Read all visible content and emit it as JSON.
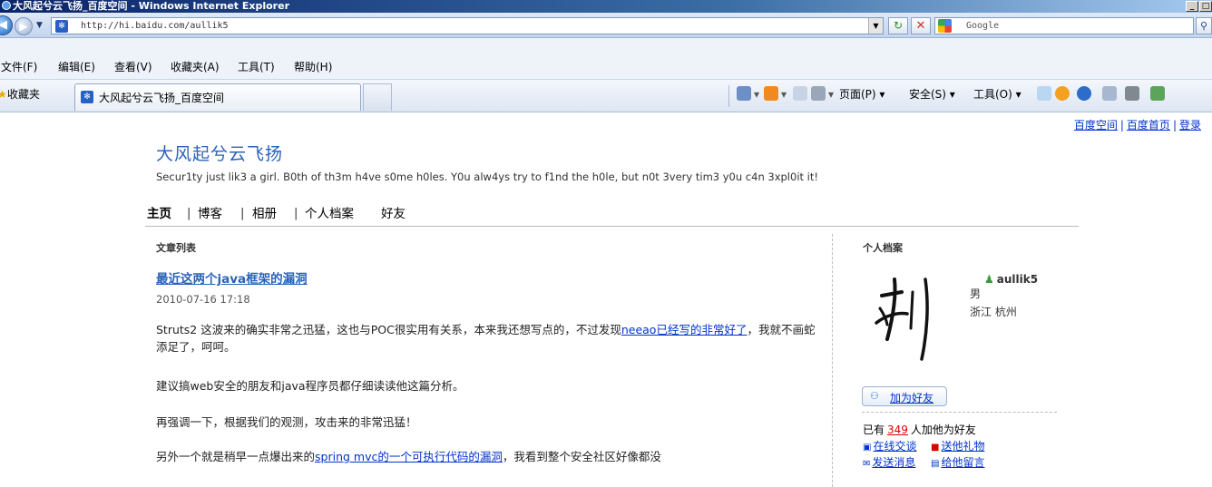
{
  "window": {
    "title": "大风起兮云飞扬_百度空间 - Windows Internet Explorer"
  },
  "address": {
    "url": "http://hi.baidu.com/aullik5",
    "search_placeholder": "Google"
  },
  "menu": {
    "items": [
      "文件(F)",
      "编辑(E)",
      "查看(V)",
      "收藏夹(A)",
      "工具(T)",
      "帮助(H)"
    ]
  },
  "favorites": {
    "label": "收藏夹",
    "tab_title": "大风起兮云飞扬_百度空间"
  },
  "commandbar": {
    "page": "页面(P) ▾",
    "safety": "安全(S) ▾",
    "tools": "工具(O) ▾"
  },
  "toplinks": [
    "百度空间",
    "百度首页",
    "登录"
  ],
  "blog": {
    "title": "大风起兮云飞扬",
    "description": "Secur1ty just lik3 a girl. B0th of th3m h4ve s0me h0les. Y0u alw4ys try to f1nd the h0le, but n0t 3very tim3 y0u c4n 3xpl0it it!",
    "nav": [
      "主页",
      "博客",
      "相册",
      "个人档案",
      "好友"
    ]
  },
  "posts_section": {
    "label": "文章列表"
  },
  "post": {
    "title": "最近这两个java框架的漏洞",
    "date": "2010-07-16 17:18",
    "p1_text": "Struts2 这波来的确实非常之迅猛，这也与POC很实用有关系，本来我还想写点的，不过发现",
    "p1_link": "neeao已经写的非常好了",
    "p1_tail": "，我就不画蛇添足了，呵呵。",
    "p2": "建议搞web安全的朋友和java程序员都仔细读读他这篇分析。",
    "p3": "再强调一下，根据我们的观测，攻击来的非常迅猛！",
    "p4_text": "另外一个就是稍早一点爆出来的",
    "p4_link": "spring mvc的一个可执行代码的漏洞",
    "p4_tail": "，我看到整个安全社区好像都没"
  },
  "profile": {
    "label": "个人档案",
    "username": "aullik5",
    "gender": "男",
    "location": "浙江 杭州",
    "add_friend": "加为好友",
    "friends_prefix": "已有",
    "friends_count": "349",
    "friends_suffix": "人加他为好友",
    "actions": [
      "在线交谈",
      "送他礼物",
      "发送消息",
      "给他留言"
    ]
  }
}
